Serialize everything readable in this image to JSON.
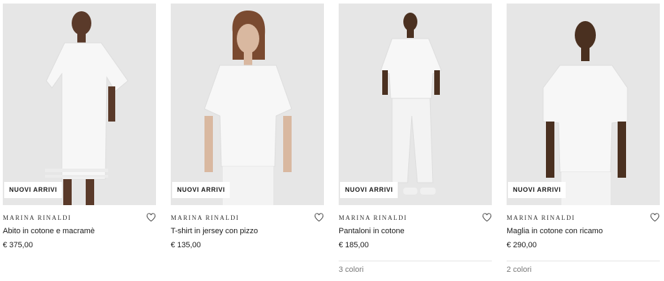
{
  "products": [
    {
      "badge": "NUOVI ARRIVI",
      "brand": "MARINA RINALDI",
      "name": "Abito in cotone e macramè",
      "price": "€ 375,00",
      "colors": ""
    },
    {
      "badge": "NUOVI ARRIVI",
      "brand": "MARINA RINALDI",
      "name": "T-shirt in jersey con pizzo",
      "price": "€ 135,00",
      "colors": ""
    },
    {
      "badge": "NUOVI ARRIVI",
      "brand": "MARINA RINALDI",
      "name": "Pantaloni in cotone",
      "price": "€ 185,00",
      "colors": "3 colori"
    },
    {
      "badge": "NUOVI ARRIVI",
      "brand": "MARINA RINALDI",
      "name": "Maglia in cotone con ricamo",
      "price": "€ 290,00",
      "colors": "2 colori"
    }
  ],
  "icons": {
    "wishlist": "heart-outline-icon"
  },
  "colors": {
    "photo_bg": "#e6e6e6",
    "garment": "#f7f7f7",
    "skin_dark": "#5a3a2a",
    "skin_light": "#d9b8a0"
  }
}
